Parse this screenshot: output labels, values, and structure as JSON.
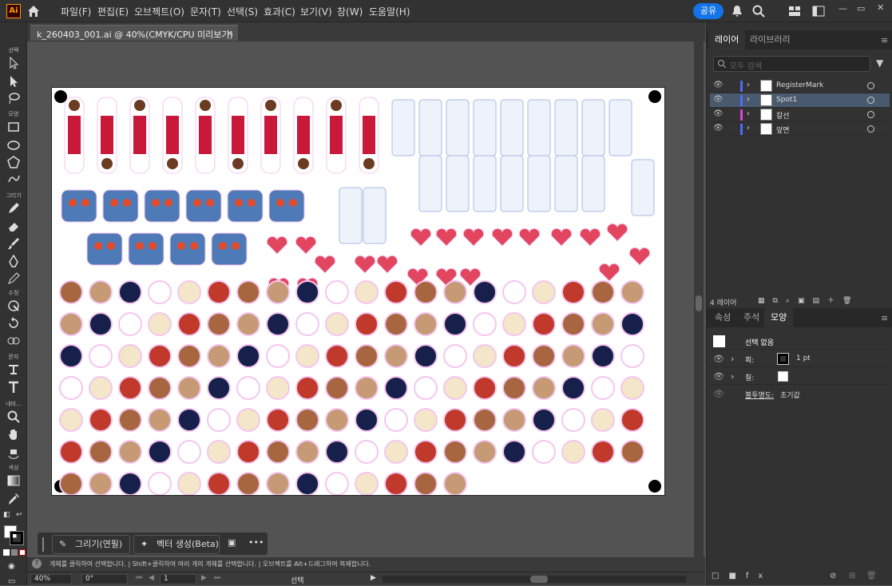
{
  "app": {
    "logo": "Ai",
    "menu": [
      "파일(F)",
      "편집(E)",
      "오브젝트(O)",
      "문자(T)",
      "선택(S)",
      "효과(C)",
      "보기(V)",
      "창(W)",
      "도움말(H)"
    ],
    "share_label": "공유"
  },
  "toolbar": {
    "labels": {
      "select": "선택",
      "shape": "모양",
      "draw": "그리기",
      "modify": "수정",
      "type": "문자",
      "navigate": "내비...",
      "color": "색상"
    }
  },
  "document": {
    "tab_title": "k_260403_001.ai @ 40%(CMYK/CPU 미리보기)",
    "tab_close": "×"
  },
  "context_bar": {
    "draw_label": "그리기(연필)",
    "vector_label": "벡터 생성(Beta)",
    "more": "•••"
  },
  "status": {
    "hint": "개체를 클릭하여 선택합니다.  |  Shift+클릭하여 여러 개의 개체를 선택합니다.  |  오브젝트를 Alt+드래그하여 복제합니다.",
    "zoom": "40%",
    "rotation": "0°",
    "artboard_num": "1",
    "tool": "선택"
  },
  "layers_panel": {
    "tabs": [
      "레이어",
      "라이브러리"
    ],
    "search_placeholder": "모두 검색",
    "layers": [
      {
        "name": "RegisterMark",
        "color": "#4f6bff",
        "selected": false
      },
      {
        "name": "Spot1",
        "color": "#4f6bff",
        "selected": true
      },
      {
        "name": "칼선",
        "color": "#e040e0",
        "selected": false
      },
      {
        "name": "앞면",
        "color": "#4f6bff",
        "selected": false
      }
    ],
    "count_label": "4 레이어"
  },
  "properties_panel": {
    "tabs": [
      "속성",
      "주석",
      "모양"
    ],
    "selection": "선택 없음",
    "stroke_label": "획:",
    "stroke_value": "1 pt",
    "fill_label": "칠:",
    "opacity_label": "불투명도:",
    "opacity_value": "초기값"
  },
  "colors": {
    "accent": "#1473e6",
    "panel_bg": "#323232",
    "canvas_bg": "#535353",
    "selected_row": "#4a5a6e"
  }
}
